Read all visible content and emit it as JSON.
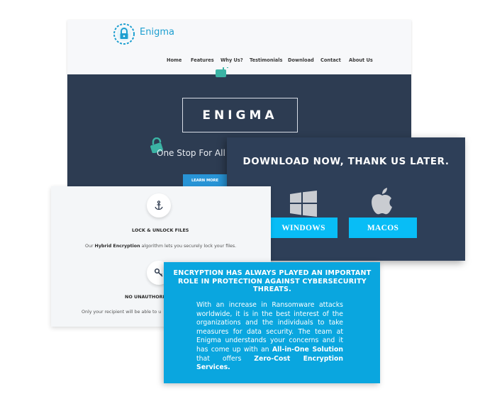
{
  "site": {
    "brand": "Enigma",
    "nav": [
      "Home",
      "Features",
      "Why Us?",
      "Testimonials",
      "Download",
      "Contact",
      "About Us"
    ],
    "hero_title": "ENIGMA",
    "tagline": "One Stop For All",
    "learn_more": "LEARN MORE"
  },
  "download": {
    "heading": "DOWNLOAD NOW, THANK US LATER.",
    "windows_label": "WINDOWS",
    "macos_label": "MACOS",
    "windows_icon": "windows-logo-icon",
    "macos_icon": "apple-logo-icon"
  },
  "features": {
    "items": [
      {
        "icon": "anchor-icon",
        "title": "LOCK & UNLOCK FILES",
        "text_prefix": "Our ",
        "text_bold": "Hybrid Encryption",
        "text_suffix": " algorithm lets you securely lock your files."
      },
      {
        "icon": "key-icon",
        "title": "NO UNAUTHORI",
        "text": "Only your recipient will be able to u"
      }
    ]
  },
  "info": {
    "heading": "ENCRYPTION HAS ALWAYS PLAYED AN IMPORTANT ROLE IN PROTECTION AGAINST CYBERSECURITY THREATS.",
    "body_1": "With an increase in Ransomware attacks worldwide, it is in the best interest of the organizations and the individuals to take measures for data security. The team at Enigma understands your concerns and it has come up with an ",
    "body_bold_1": "All-in-One Solution",
    "body_2": " that offers ",
    "body_bold_2": "Zero-Cost Encryption Services."
  },
  "colors": {
    "hero_bg": "#2d3c52",
    "download_bg": "#2e3f58",
    "os_button": "#08bdf6",
    "info_bg": "#0aa6df",
    "brand_blue": "#1d9fd0",
    "learn_button": "#2894d6"
  }
}
